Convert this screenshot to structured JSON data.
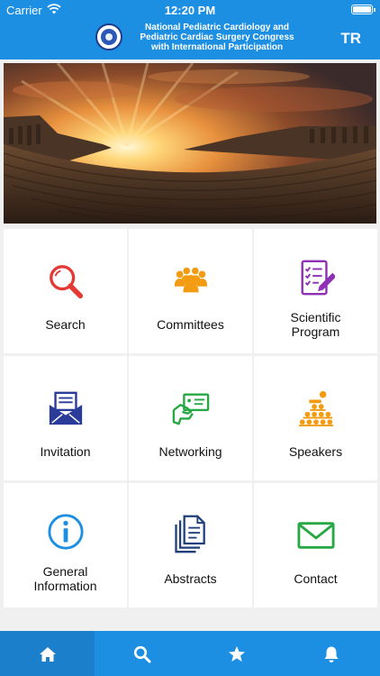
{
  "status_bar": {
    "carrier": "Carrier",
    "time": "12:20 PM"
  },
  "header": {
    "title_line1": "National Pediatric Cardiology and",
    "title_line2": "Pediatric Cardiac Surgery Congress",
    "title_line3": "with International Participation",
    "language_button": "TR",
    "color": "#1c8fe3"
  },
  "tiles": [
    {
      "line1": "Search",
      "line2": "",
      "icon": "magnifier-icon"
    },
    {
      "line1": "Committees",
      "line2": "",
      "icon": "people-group-icon"
    },
    {
      "line1": "Scientific",
      "line2": "Program",
      "icon": "checklist-icon"
    },
    {
      "line1": "Invitation",
      "line2": "",
      "icon": "envelope-letter-icon"
    },
    {
      "line1": "Networking",
      "line2": "",
      "icon": "hand-card-icon"
    },
    {
      "line1": "Speakers",
      "line2": "",
      "icon": "audience-icon"
    },
    {
      "line1": "General",
      "line2": "Information",
      "icon": "info-icon"
    },
    {
      "line1": "Abstracts",
      "line2": "",
      "icon": "documents-icon"
    },
    {
      "line1": "Contact",
      "line2": "",
      "icon": "mail-icon"
    }
  ],
  "tab_bar": {
    "tabs": [
      "home-icon",
      "search-icon",
      "star-icon",
      "bell-icon"
    ],
    "active": "home-icon"
  }
}
